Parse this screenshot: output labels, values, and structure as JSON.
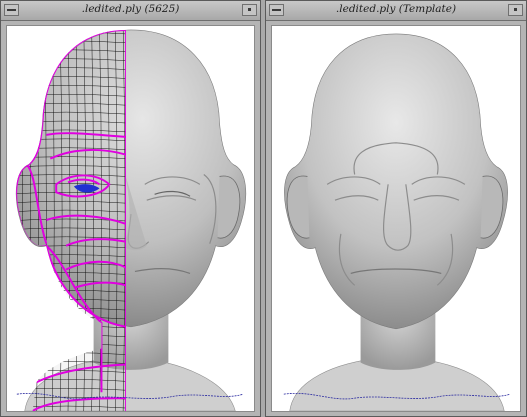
{
  "windows": [
    {
      "title": ".ledited.ply (5625)",
      "content": "head mesh with fitted template grid overlay",
      "overlay_color": "#e000e0",
      "grid_color": "#111111"
    },
    {
      "title": ".ledited.ply (Template)",
      "content": "smooth shaded head mesh",
      "overlay_color": "",
      "grid_color": ""
    }
  ],
  "colors": {
    "mesh_gray": "#c8c8c8",
    "background": "#ffffff",
    "noise_blue": "#2a2aa0"
  },
  "icons": [
    "window-menu-icon",
    "minimize-icon"
  ]
}
